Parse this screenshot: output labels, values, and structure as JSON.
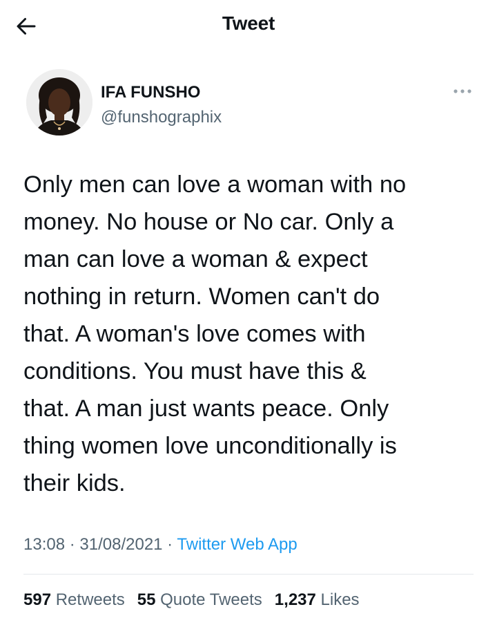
{
  "header": {
    "title": "Tweet",
    "back_icon": "arrow-left-icon"
  },
  "author": {
    "display_name": "IFA FUNSHO",
    "handle": "@funshographix",
    "more_icon": "more-horizontal-icon"
  },
  "tweet": {
    "text": "Only men can love a woman with no\nmoney. No house or No car. Only a\nman can love a woman & expect\nnothing in return. Women can't do\nthat. A woman's love comes with\nconditions. You must have this &\nthat. A man just wants peace. Only\nthing women love unconditionally is\ntheir kids."
  },
  "meta": {
    "time": "13:08",
    "separator": " · ",
    "date": "31/08/2021",
    "source": "Twitter Web App"
  },
  "stats": {
    "retweets_count": "597",
    "retweets_label": "Retweets",
    "quotes_count": "55",
    "quotes_label": "Quote Tweets",
    "likes_count": "1,237",
    "likes_label": "Likes"
  },
  "colors": {
    "text": "#0f1419",
    "secondary": "#536471",
    "link": "#1d9bf0"
  }
}
